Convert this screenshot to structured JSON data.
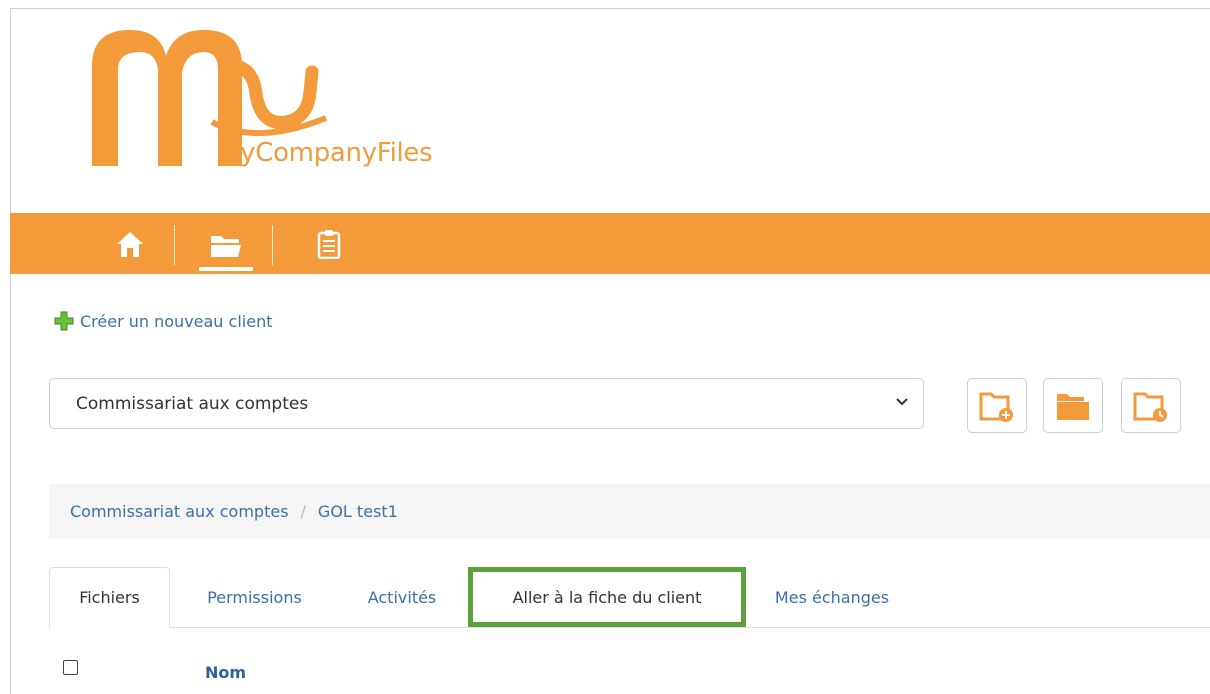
{
  "brand": {
    "name": "MyCompanyFiles",
    "color": "#f39a3a"
  },
  "nav": {
    "items": [
      {
        "name": "home",
        "icon": "home-icon",
        "active": false
      },
      {
        "name": "files",
        "icon": "open-folder-icon",
        "active": true
      },
      {
        "name": "tasks",
        "icon": "clipboard-icon",
        "active": false
      }
    ]
  },
  "actions": {
    "create_client_label": "Créer un nouveau client",
    "create_icon": "green-plus-icon"
  },
  "select": {
    "value": "Commissariat aux comptes"
  },
  "toolbar": {
    "buttons": [
      {
        "icon": "folder-add-icon"
      },
      {
        "icon": "folders-icon"
      },
      {
        "icon": "folder-clock-icon"
      }
    ]
  },
  "breadcrumb": {
    "items": [
      "Commissariat aux comptes",
      "GOL test1"
    ],
    "separator": "/"
  },
  "tabs": {
    "items": [
      "Fichiers",
      "Permissions",
      "Activités",
      "Aller à la fiche du client",
      "Mes échanges"
    ],
    "active": "Fichiers",
    "highlighted": "Aller à la fiche du client",
    "highlight_color": "#5aa03c"
  },
  "table": {
    "columns": [
      "Nom"
    ]
  }
}
